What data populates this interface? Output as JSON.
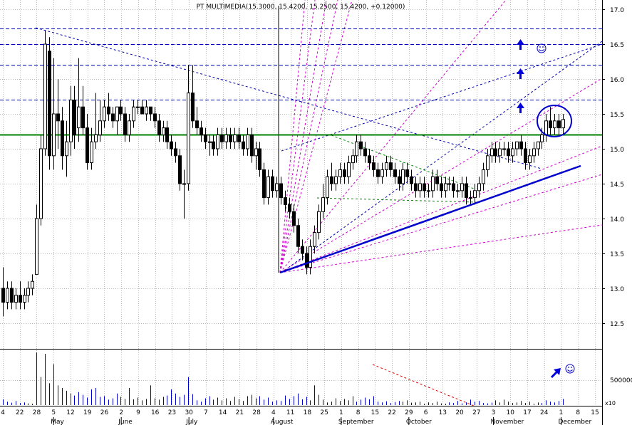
{
  "chart_data": {
    "type": "candlestick",
    "title": "PT MULTIMEDIA(15.3000, 15.4200, 15.2500, 15.4200, +0.12000)",
    "y_ticks": [
      "17.0",
      "16.5",
      "16.0",
      "15.5",
      "15.0",
      "14.5",
      "14.0",
      "13.5",
      "13.0",
      "12.5"
    ],
    "ylim": [
      12.1,
      17.2
    ],
    "volume_tick": "500000",
    "volume_multiplier": "x10",
    "volume_max": 750000,
    "day_labels": [
      "4",
      "22",
      "28",
      "5",
      "12",
      "19",
      "26",
      "2",
      "9",
      "16",
      "23",
      "30",
      "7",
      "14",
      "21",
      "28",
      "4",
      "11",
      "18",
      "25",
      "1",
      "8",
      "15",
      "22",
      "29",
      "6",
      "13",
      "20",
      "27",
      "3",
      "10",
      "17",
      "24",
      "1",
      "8",
      "15"
    ],
    "month_labels": [
      "May",
      "June",
      "July",
      "August",
      "September",
      "October",
      "November",
      "December"
    ],
    "resistance_levels": [
      16.72,
      16.5,
      16.2,
      15.7
    ],
    "support_level": 15.2,
    "candles": [
      [
        13.0,
        13.3,
        12.6,
        12.8
      ],
      [
        12.8,
        13.1,
        12.7,
        13.0
      ],
      [
        13.0,
        13.1,
        12.7,
        12.8
      ],
      [
        12.8,
        13.0,
        12.7,
        12.9
      ],
      [
        12.9,
        13.1,
        12.7,
        12.8
      ],
      [
        12.8,
        13.0,
        12.7,
        12.9
      ],
      [
        12.9,
        13.1,
        12.8,
        13.0
      ],
      [
        13.0,
        13.2,
        12.9,
        13.1
      ],
      [
        13.2,
        14.2,
        13.2,
        14.0
      ],
      [
        14.0,
        15.2,
        13.9,
        15.0
      ],
      [
        15.0,
        16.7,
        14.9,
        16.5
      ],
      [
        16.4,
        16.6,
        14.7,
        14.9
      ],
      [
        14.9,
        16.3,
        14.7,
        15.5
      ],
      [
        15.5,
        16.0,
        15.0,
        15.4
      ],
      [
        15.4,
        15.6,
        14.7,
        14.9
      ],
      [
        14.9,
        15.4,
        14.6,
        15.1
      ],
      [
        15.1,
        15.9,
        14.9,
        15.7
      ],
      [
        15.7,
        15.9,
        15.0,
        15.2
      ],
      [
        15.3,
        16.3,
        15.1,
        15.6
      ],
      [
        15.6,
        15.9,
        15.2,
        15.3
      ],
      [
        15.3,
        15.5,
        14.7,
        14.8
      ],
      [
        14.8,
        15.3,
        14.7,
        15.1
      ],
      [
        15.1,
        15.8,
        15.0,
        15.2
      ],
      [
        15.2,
        15.7,
        15.1,
        15.4
      ],
      [
        15.4,
        15.7,
        15.3,
        15.6
      ],
      [
        15.6,
        15.8,
        15.4,
        15.5
      ],
      [
        15.5,
        15.6,
        15.3,
        15.4
      ],
      [
        15.4,
        15.6,
        15.2,
        15.6
      ],
      [
        15.6,
        15.7,
        15.4,
        15.5
      ],
      [
        15.5,
        15.6,
        15.1,
        15.2
      ],
      [
        15.2,
        15.5,
        15.1,
        15.4
      ],
      [
        15.4,
        15.7,
        15.3,
        15.6
      ],
      [
        15.6,
        15.7,
        15.5,
        15.6
      ],
      [
        15.6,
        15.7,
        15.5,
        15.5
      ],
      [
        15.5,
        15.7,
        15.4,
        15.6
      ],
      [
        15.6,
        15.6,
        15.4,
        15.5
      ],
      [
        15.5,
        15.6,
        15.3,
        15.4
      ],
      [
        15.4,
        15.5,
        15.1,
        15.2
      ],
      [
        15.2,
        15.4,
        15.1,
        15.3
      ],
      [
        15.3,
        15.4,
        15.0,
        15.1
      ],
      [
        15.1,
        15.2,
        14.9,
        15.0
      ],
      [
        15.0,
        15.1,
        14.8,
        14.9
      ],
      [
        14.9,
        15.0,
        14.4,
        14.5
      ],
      [
        14.5,
        14.7,
        14.0,
        14.5
      ],
      [
        14.5,
        16.2,
        14.4,
        15.8
      ],
      [
        15.8,
        16.2,
        15.3,
        15.4
      ],
      [
        15.4,
        15.6,
        15.2,
        15.3
      ],
      [
        15.3,
        15.4,
        15.1,
        15.2
      ],
      [
        15.2,
        15.3,
        15.0,
        15.1
      ],
      [
        15.1,
        15.2,
        14.9,
        15.1
      ],
      [
        15.1,
        15.2,
        14.9,
        15.0
      ],
      [
        15.0,
        15.3,
        14.9,
        15.2
      ],
      [
        15.2,
        15.3,
        15.0,
        15.1
      ],
      [
        15.1,
        15.3,
        15.0,
        15.2
      ],
      [
        15.2,
        15.3,
        15.0,
        15.1
      ],
      [
        15.1,
        15.3,
        15.0,
        15.2
      ],
      [
        15.2,
        15.3,
        15.0,
        15.1
      ],
      [
        15.1,
        15.2,
        14.9,
        15.0
      ],
      [
        15.0,
        15.3,
        14.9,
        15.2
      ],
      [
        15.2,
        15.3,
        14.8,
        14.9
      ],
      [
        14.9,
        15.1,
        14.7,
        15.0
      ],
      [
        15.0,
        15.1,
        14.6,
        14.7
      ],
      [
        14.7,
        14.8,
        14.2,
        14.3
      ],
      [
        14.3,
        14.7,
        14.2,
        14.6
      ],
      [
        14.6,
        14.7,
        14.3,
        14.4
      ],
      [
        14.4,
        14.6,
        14.3,
        14.5
      ],
      [
        14.5,
        14.6,
        14.2,
        14.3
      ],
      [
        14.3,
        14.4,
        14.1,
        14.2
      ],
      [
        14.2,
        14.3,
        14.0,
        14.1
      ],
      [
        14.1,
        14.2,
        13.8,
        13.9
      ],
      [
        13.9,
        14.0,
        13.5,
        13.6
      ],
      [
        13.6,
        13.7,
        13.4,
        13.5
      ],
      [
        13.5,
        13.6,
        13.2,
        13.3
      ],
      [
        13.3,
        13.7,
        13.2,
        13.6
      ],
      [
        13.6,
        13.9,
        13.5,
        13.8
      ],
      [
        13.8,
        14.2,
        13.7,
        14.1
      ],
      [
        14.1,
        14.5,
        14.0,
        14.3
      ],
      [
        14.3,
        14.7,
        14.2,
        14.6
      ],
      [
        14.6,
        14.8,
        14.4,
        14.5
      ],
      [
        14.5,
        14.7,
        14.4,
        14.6
      ],
      [
        14.6,
        14.8,
        14.5,
        14.7
      ],
      [
        14.7,
        14.8,
        14.5,
        14.6
      ],
      [
        14.6,
        14.9,
        14.5,
        14.8
      ],
      [
        14.8,
        15.0,
        14.7,
        14.9
      ],
      [
        14.9,
        15.2,
        14.8,
        15.1
      ],
      [
        15.1,
        15.2,
        14.9,
        15.0
      ],
      [
        15.0,
        15.1,
        14.8,
        14.9
      ],
      [
        14.9,
        15.0,
        14.7,
        14.8
      ],
      [
        14.8,
        14.9,
        14.6,
        14.7
      ],
      [
        14.7,
        14.8,
        14.5,
        14.6
      ],
      [
        14.6,
        14.8,
        14.5,
        14.7
      ],
      [
        14.7,
        14.9,
        14.6,
        14.8
      ],
      [
        14.8,
        14.9,
        14.6,
        14.7
      ],
      [
        14.7,
        14.8,
        14.5,
        14.6
      ],
      [
        14.6,
        14.7,
        14.4,
        14.5
      ],
      [
        14.5,
        14.8,
        14.4,
        14.7
      ],
      [
        14.7,
        14.8,
        14.5,
        14.6
      ],
      [
        14.6,
        14.7,
        14.4,
        14.5
      ],
      [
        14.5,
        14.6,
        14.3,
        14.4
      ],
      [
        14.4,
        14.6,
        14.3,
        14.5
      ],
      [
        14.5,
        14.6,
        14.3,
        14.4
      ],
      [
        14.4,
        14.5,
        14.3,
        14.4
      ],
      [
        14.4,
        14.7,
        14.3,
        14.6
      ],
      [
        14.6,
        14.7,
        14.4,
        14.5
      ],
      [
        14.5,
        14.6,
        14.3,
        14.4
      ],
      [
        14.4,
        14.6,
        14.3,
        14.5
      ],
      [
        14.5,
        14.6,
        14.4,
        14.5
      ],
      [
        14.5,
        14.6,
        14.3,
        14.4
      ],
      [
        14.4,
        14.5,
        14.3,
        14.4
      ],
      [
        14.4,
        14.6,
        14.3,
        14.5
      ],
      [
        14.5,
        14.6,
        14.2,
        14.3
      ],
      [
        14.3,
        14.4,
        14.2,
        14.3
      ],
      [
        14.3,
        14.5,
        14.2,
        14.4
      ],
      [
        14.4,
        14.6,
        14.3,
        14.5
      ],
      [
        14.5,
        14.8,
        14.4,
        14.7
      ],
      [
        14.7,
        15.0,
        14.6,
        14.9
      ],
      [
        14.9,
        15.1,
        14.8,
        15.0
      ],
      [
        15.0,
        15.1,
        14.8,
        14.9
      ],
      [
        14.9,
        15.1,
        14.8,
        15.0
      ],
      [
        15.0,
        15.1,
        14.9,
        15.0
      ],
      [
        15.0,
        15.1,
        14.8,
        14.9
      ],
      [
        14.9,
        15.1,
        14.8,
        15.0
      ],
      [
        15.0,
        15.1,
        14.9,
        15.1
      ],
      [
        15.1,
        15.2,
        14.9,
        15.0
      ],
      [
        15.0,
        15.1,
        14.7,
        14.8
      ],
      [
        14.8,
        15.0,
        14.7,
        14.9
      ],
      [
        14.9,
        15.1,
        14.8,
        15.0
      ],
      [
        15.0,
        15.1,
        14.9,
        15.1
      ],
      [
        15.1,
        15.3,
        15.0,
        15.2
      ],
      [
        15.2,
        15.5,
        15.1,
        15.4
      ],
      [
        15.4,
        15.6,
        15.2,
        15.3
      ],
      [
        15.3,
        15.5,
        15.2,
        15.4
      ],
      [
        15.4,
        15.5,
        15.2,
        15.3
      ],
      [
        15.3,
        15.5,
        15.2,
        15.42
      ]
    ],
    "volume": [
      95000,
      60000,
      45000,
      70000,
      40000,
      50000,
      35000,
      30000,
      780000,
      420000,
      760000,
      330000,
      610000,
      300000,
      260000,
      220000,
      180000,
      150000,
      200000,
      160000,
      120000,
      240000,
      260000,
      130000,
      140000,
      90000,
      110000,
      180000,
      130000,
      100000,
      260000,
      95000,
      120000,
      80000,
      100000,
      300000,
      110000,
      90000,
      130000,
      150000,
      240000,
      180000,
      130000,
      160000,
      420000,
      170000,
      80000,
      60000,
      110000,
      140000,
      90000,
      120000,
      80000,
      110000,
      70000,
      130000,
      95000,
      70000,
      140000,
      160000,
      110000,
      140000,
      90000,
      120000,
      60000,
      80000,
      70000,
      150000,
      100000,
      140000,
      180000,
      95000,
      130000,
      80000,
      300000,
      160000,
      90000,
      50000,
      60000,
      110000,
      70000,
      100000,
      80000,
      140000,
      60000,
      90000,
      120000,
      95000,
      140000,
      60000,
      50000,
      65000,
      40000,
      55000,
      70000,
      60000,
      80000,
      45000,
      50000,
      60000,
      30000,
      50000,
      40000,
      60000,
      35000,
      30000,
      50000,
      40000,
      70000,
      35000,
      50000,
      90000,
      60000,
      70000,
      40000,
      35000,
      45000,
      80000,
      50000,
      90000,
      60000,
      40000,
      50000,
      70000,
      40000,
      60000,
      30000,
      50000,
      40000,
      80000,
      60000,
      50000,
      70000,
      100000,
      420000,
      470000,
      90000,
      60000,
      40000,
      50000
    ]
  }
}
